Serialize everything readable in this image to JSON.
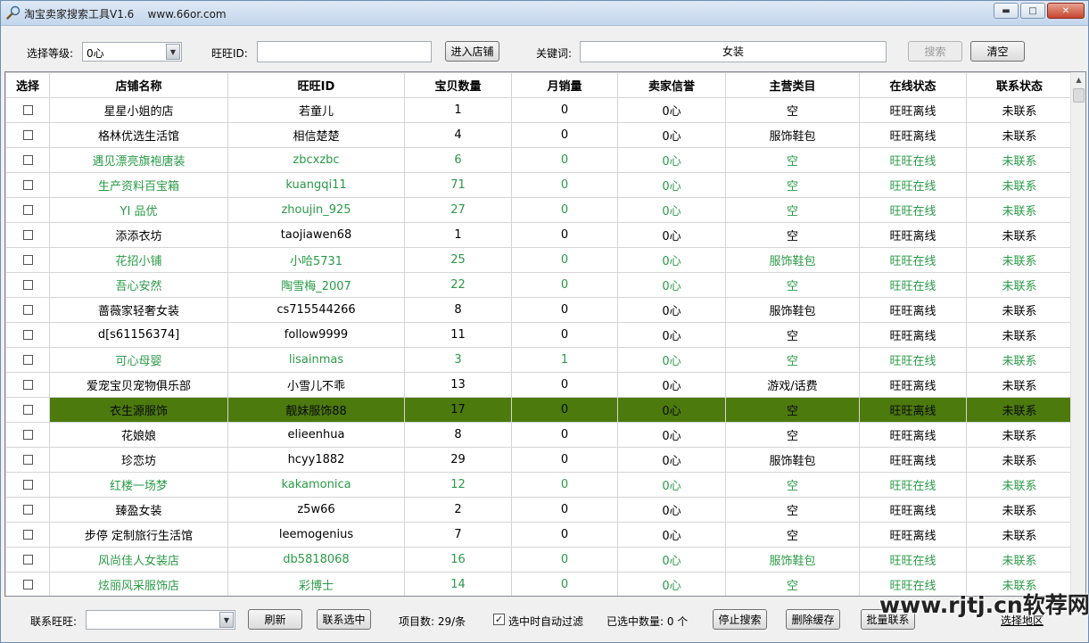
{
  "window": {
    "title": "淘宝卖家搜索工具V1.6    www.66or.com",
    "min_icon": "minimize-icon",
    "max_icon": "maximize-icon",
    "close_icon": "close-icon"
  },
  "toolbar": {
    "level_label": "选择等级:",
    "level_value": "0心",
    "wangwang_label": "旺旺ID:",
    "wangwang_value": "",
    "enter_shop_label": "进入店铺",
    "keyword_label": "关键词:",
    "keyword_value": "女装",
    "search_label": "搜索",
    "clear_label": "清空"
  },
  "table": {
    "columns": [
      "选择",
      "店铺名称",
      "旺旺ID",
      "宝贝数量",
      "月销量",
      "卖家信誉",
      "主营类目",
      "在线状态",
      "联系状态"
    ],
    "rows": [
      {
        "name": "星星小姐的店",
        "id": "若童儿",
        "items": "1",
        "sales": "0",
        "credit": "0心",
        "cat": "空",
        "status": "旺旺离线",
        "contact": "未联系",
        "online": false
      },
      {
        "name": "格林优选生活馆",
        "id": "相信楚楚",
        "items": "4",
        "sales": "0",
        "credit": "0心",
        "cat": "服饰鞋包",
        "status": "旺旺离线",
        "contact": "未联系",
        "online": false
      },
      {
        "name": "遇见漂亮旗袍唐装",
        "id": "zbcxzbc",
        "items": "6",
        "sales": "0",
        "credit": "0心",
        "cat": "空",
        "status": "旺旺在线",
        "contact": "未联系",
        "online": true
      },
      {
        "name": "生产资料百宝箱",
        "id": "kuangqi11",
        "items": "71",
        "sales": "0",
        "credit": "0心",
        "cat": "空",
        "status": "旺旺在线",
        "contact": "未联系",
        "online": true
      },
      {
        "name": "YI 品优",
        "id": "zhoujin_925",
        "items": "27",
        "sales": "0",
        "credit": "0心",
        "cat": "空",
        "status": "旺旺在线",
        "contact": "未联系",
        "online": true
      },
      {
        "name": "添添衣坊",
        "id": "taojiawen68",
        "items": "1",
        "sales": "0",
        "credit": "0心",
        "cat": "空",
        "status": "旺旺离线",
        "contact": "未联系",
        "online": false
      },
      {
        "name": "花招小铺",
        "id": "小哈5731",
        "items": "25",
        "sales": "0",
        "credit": "0心",
        "cat": "服饰鞋包",
        "status": "旺旺在线",
        "contact": "未联系",
        "online": true
      },
      {
        "name": "吾心安然",
        "id": "陶雪梅_2007",
        "items": "22",
        "sales": "0",
        "credit": "0心",
        "cat": "空",
        "status": "旺旺在线",
        "contact": "未联系",
        "online": true
      },
      {
        "name": "蔷薇家轻奢女装",
        "id": "cs715544266",
        "items": "8",
        "sales": "0",
        "credit": "0心",
        "cat": "服饰鞋包",
        "status": "旺旺离线",
        "contact": "未联系",
        "online": false
      },
      {
        "name": "d[s61156374]",
        "id": "follow9999",
        "items": "11",
        "sales": "0",
        "credit": "0心",
        "cat": "空",
        "status": "旺旺离线",
        "contact": "未联系",
        "online": false
      },
      {
        "name": "可心母婴",
        "id": "lisainmas",
        "items": "3",
        "sales": "1",
        "credit": "0心",
        "cat": "空",
        "status": "旺旺在线",
        "contact": "未联系",
        "online": true
      },
      {
        "name": "爱宠宝贝宠物俱乐部",
        "id": "小雪儿不乖",
        "items": "13",
        "sales": "0",
        "credit": "0心",
        "cat": "游戏/话费",
        "status": "旺旺离线",
        "contact": "未联系",
        "online": false
      },
      {
        "name": "衣生源服饰",
        "id": "靓妹服饰88",
        "items": "17",
        "sales": "0",
        "credit": "0心",
        "cat": "空",
        "status": "旺旺离线",
        "contact": "未联系",
        "online": false,
        "selected": true
      },
      {
        "name": "花娘娘",
        "id": "elieenhua",
        "items": "8",
        "sales": "0",
        "credit": "0心",
        "cat": "空",
        "status": "旺旺离线",
        "contact": "未联系",
        "online": false
      },
      {
        "name": "珍恋坊",
        "id": "hcyy1882",
        "items": "29",
        "sales": "0",
        "credit": "0心",
        "cat": "服饰鞋包",
        "status": "旺旺离线",
        "contact": "未联系",
        "online": false
      },
      {
        "name": "红楼一场梦",
        "id": "kakamonica",
        "items": "12",
        "sales": "0",
        "credit": "0心",
        "cat": "空",
        "status": "旺旺在线",
        "contact": "未联系",
        "online": true
      },
      {
        "name": "臻盈女装",
        "id": "z5w66",
        "items": "2",
        "sales": "0",
        "credit": "0心",
        "cat": "空",
        "status": "旺旺离线",
        "contact": "未联系",
        "online": false
      },
      {
        "name": "步停 定制旅行生活馆",
        "id": "leemogenius",
        "items": "7",
        "sales": "0",
        "credit": "0心",
        "cat": "空",
        "status": "旺旺离线",
        "contact": "未联系",
        "online": false
      },
      {
        "name": "风尚佳人女装店",
        "id": "db5818068",
        "items": "16",
        "sales": "0",
        "credit": "0心",
        "cat": "服饰鞋包",
        "status": "旺旺在线",
        "contact": "未联系",
        "online": true
      },
      {
        "name": "炫丽风采服饰店",
        "id": "彩博士",
        "items": "14",
        "sales": "0",
        "credit": "0心",
        "cat": "空",
        "status": "旺旺在线",
        "contact": "未联系",
        "online": true
      }
    ]
  },
  "bottom": {
    "contact_label": "联系旺旺:",
    "contact_value": "",
    "refresh_label": "刷新",
    "contact_selected_label": "联系选中",
    "count_text": "项目数: 29/条",
    "auto_filter_label": "选中时自动过滤",
    "selected_count_text": "已选中数量: 0 个",
    "stop_search_label": "停止搜索",
    "delete_cache_label": "删除缓存",
    "batch_contact_label": "批量联系",
    "region_label": "选择地区"
  },
  "watermark": "www.rjtj.cn软荐网"
}
